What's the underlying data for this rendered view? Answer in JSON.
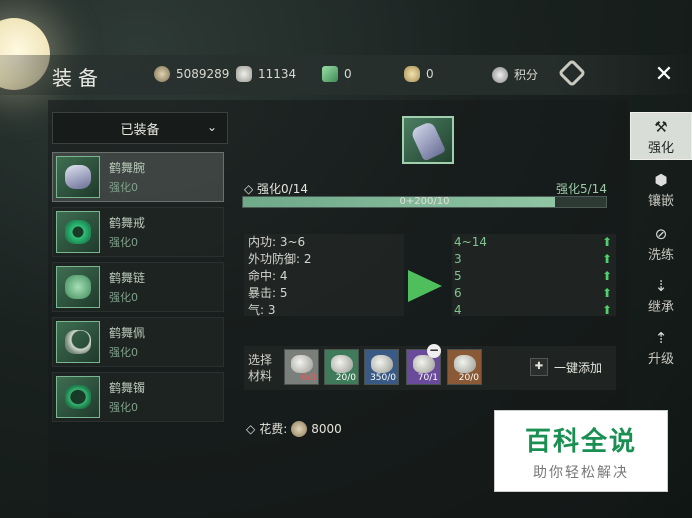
{
  "header": {
    "title": "装备",
    "currencies": [
      {
        "icon": "coin-icon",
        "value": "5089289"
      },
      {
        "icon": "silver-icon",
        "value": "11134"
      },
      {
        "icon": "jade-icon",
        "value": "0"
      },
      {
        "icon": "ingot-icon",
        "value": "0"
      },
      {
        "icon": "points-icon",
        "value": "积分"
      }
    ],
    "close_label": "✕"
  },
  "dropdown": {
    "label": "已装备",
    "chevron": "⌄"
  },
  "equipment": [
    {
      "name": "鹤舞腕",
      "level": "强化0",
      "color": "#b9bfe0"
    },
    {
      "name": "鹤舞戒",
      "level": "强化0",
      "color": "#2fc27a"
    },
    {
      "name": "鹤舞链",
      "level": "强化0",
      "color": "#62c28a"
    },
    {
      "name": "鹤舞佩",
      "level": "强化0",
      "color": "#cfd8cc"
    },
    {
      "name": "鹤舞镯",
      "level": "强化0",
      "color": "#36b472"
    }
  ],
  "enhance": {
    "current": "强化0/14",
    "target": "强化5/14",
    "progress_text": "0+200/10",
    "progress_fraction": 0.86
  },
  "stats_before": [
    {
      "label": "内功: 3~6"
    },
    {
      "label": "外功防御: 2"
    },
    {
      "label": "命中: 4"
    },
    {
      "label": "暴击: 5"
    },
    {
      "label": "气: 3"
    }
  ],
  "stats_after": [
    {
      "value": "4~14"
    },
    {
      "value": "3"
    },
    {
      "value": "5"
    },
    {
      "value": "6"
    },
    {
      "value": "4"
    }
  ],
  "materials": {
    "label": "选择材料",
    "items": [
      {
        "count": "0/0",
        "bg": "#7a7f7c",
        "red": true
      },
      {
        "count": "20/0",
        "bg": "#3f7a5a",
        "red": false
      },
      {
        "count": "350/0",
        "bg": "#3a5a86",
        "red": false
      },
      {
        "count": "70/1",
        "bg": "#6a4a9a",
        "red": false
      },
      {
        "count": "20/0",
        "bg": "#8a5a36",
        "red": false
      }
    ],
    "minus": "−"
  },
  "one_click_add": "一键添加",
  "cost": {
    "label": "花费:",
    "value": "8000"
  },
  "side_tabs": [
    {
      "label": "强化",
      "icon": "hammer-icon",
      "glyph": "⚒",
      "active": true
    },
    {
      "label": "镶嵌",
      "icon": "gem-icon",
      "glyph": "⬢",
      "active": false
    },
    {
      "label": "洗练",
      "icon": "refine-icon",
      "glyph": "⊘",
      "active": false
    },
    {
      "label": "继承",
      "icon": "inherit-icon",
      "glyph": "⇣",
      "active": false
    },
    {
      "label": "升级",
      "icon": "upgrade-icon",
      "glyph": "⇡",
      "active": false
    }
  ],
  "watermark": {
    "title": "百科全说",
    "subtitle": "助你轻松解决"
  }
}
